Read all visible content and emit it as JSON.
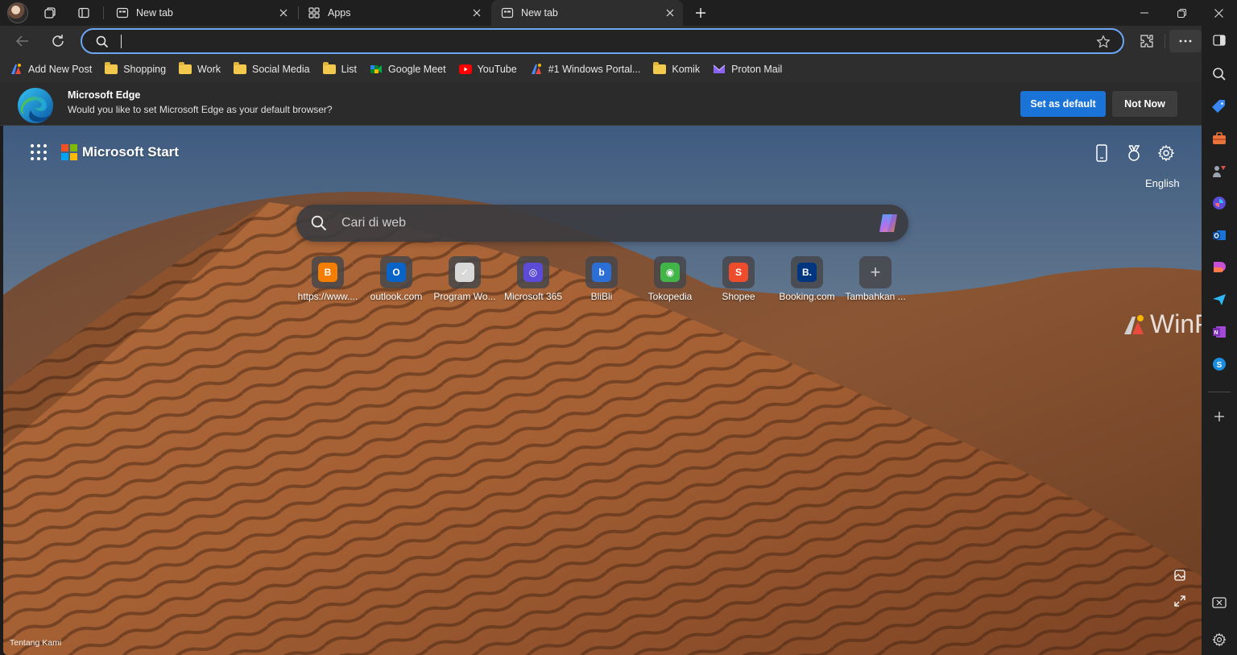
{
  "tabs": [
    {
      "title": "New tab",
      "active": false
    },
    {
      "title": "Apps",
      "active": false
    },
    {
      "title": "New tab",
      "active": true
    }
  ],
  "address": {
    "value": ""
  },
  "favorites": [
    {
      "label": "Add New Post",
      "icon": "wordpress-icon"
    },
    {
      "label": "Shopping",
      "icon": "folder-icon"
    },
    {
      "label": "Work",
      "icon": "folder-icon"
    },
    {
      "label": "Social Media",
      "icon": "folder-icon"
    },
    {
      "label": "List",
      "icon": "folder-icon"
    },
    {
      "label": "Google Meet",
      "icon": "google-meet-icon"
    },
    {
      "label": "YouTube",
      "icon": "youtube-icon"
    },
    {
      "label": "#1 Windows Portal...",
      "icon": "winpoin-icon"
    },
    {
      "label": "Komik",
      "icon": "folder-icon"
    },
    {
      "label": "Proton Mail",
      "icon": "proton-mail-icon"
    }
  ],
  "infobar": {
    "title": "Microsoft Edge",
    "message": "Would you like to set Microsoft Edge as your default browser?",
    "primary_label": "Set as default",
    "secondary_label": "Not Now"
  },
  "newtab": {
    "brand": "Microsoft Start",
    "language": "English",
    "search_placeholder": "Cari di web",
    "footer": "Tentang Kami",
    "watermark": "WinPoin",
    "tiles": [
      {
        "label": "https://www....",
        "icon": "blogger-icon",
        "color": "#f57d00",
        "glyph": "B"
      },
      {
        "label": "outlook.com",
        "icon": "outlook-icon",
        "color": "#0a64c8",
        "glyph": "O"
      },
      {
        "label": "Program Wo...",
        "icon": "program-icon",
        "color": "#d8d8d8",
        "glyph": "✓"
      },
      {
        "label": "Microsoft 365",
        "icon": "microsoft-365-icon",
        "color": "#5b4bd6",
        "glyph": "◎"
      },
      {
        "label": "BliBli",
        "icon": "blibli-icon",
        "color": "#2b6fd6",
        "glyph": "b"
      },
      {
        "label": "Tokopedia",
        "icon": "tokopedia-icon",
        "color": "#42b549",
        "glyph": "◉"
      },
      {
        "label": "Shopee",
        "icon": "shopee-icon",
        "color": "#ee4d2d",
        "glyph": "S"
      },
      {
        "label": "Booking.com",
        "icon": "booking-icon",
        "color": "#003580",
        "glyph": "B."
      },
      {
        "label": "Tambahkan ...",
        "icon": "plus-icon",
        "color": "transparent",
        "glyph": "+"
      }
    ]
  },
  "colors": {
    "accent": "#1a73d6",
    "omnibox_border": "#6ba7f5"
  }
}
